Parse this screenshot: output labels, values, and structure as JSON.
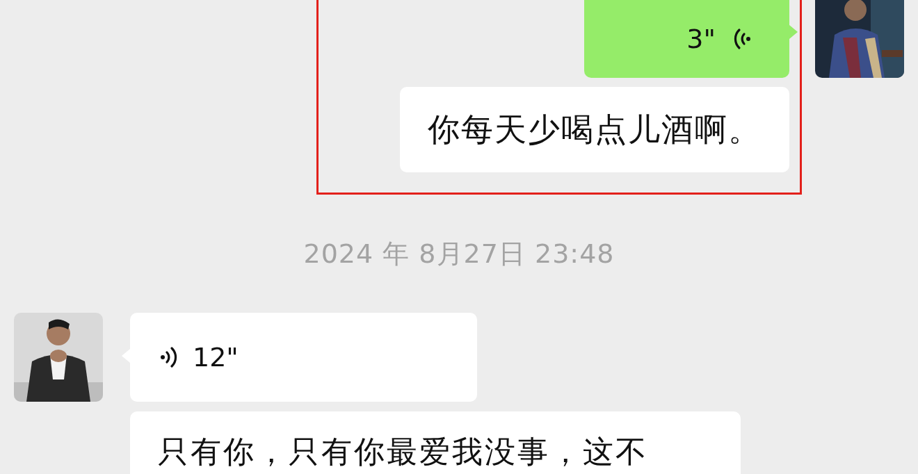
{
  "outgoing": {
    "highlighted": true,
    "messages": [
      {
        "kind": "voice",
        "avatar": true,
        "duration": "3\""
      },
      {
        "kind": "text",
        "avatar": false,
        "text": "你每天少喝点儿酒啊。"
      }
    ]
  },
  "timestamp": "2024 年 8月27日 23:48",
  "incoming": {
    "highlighted": false,
    "messages": [
      {
        "kind": "voice",
        "avatar": true,
        "duration": "12\""
      },
      {
        "kind": "text",
        "avatar": false,
        "text": "只有你，只有你最爱我没事，这不"
      }
    ]
  }
}
